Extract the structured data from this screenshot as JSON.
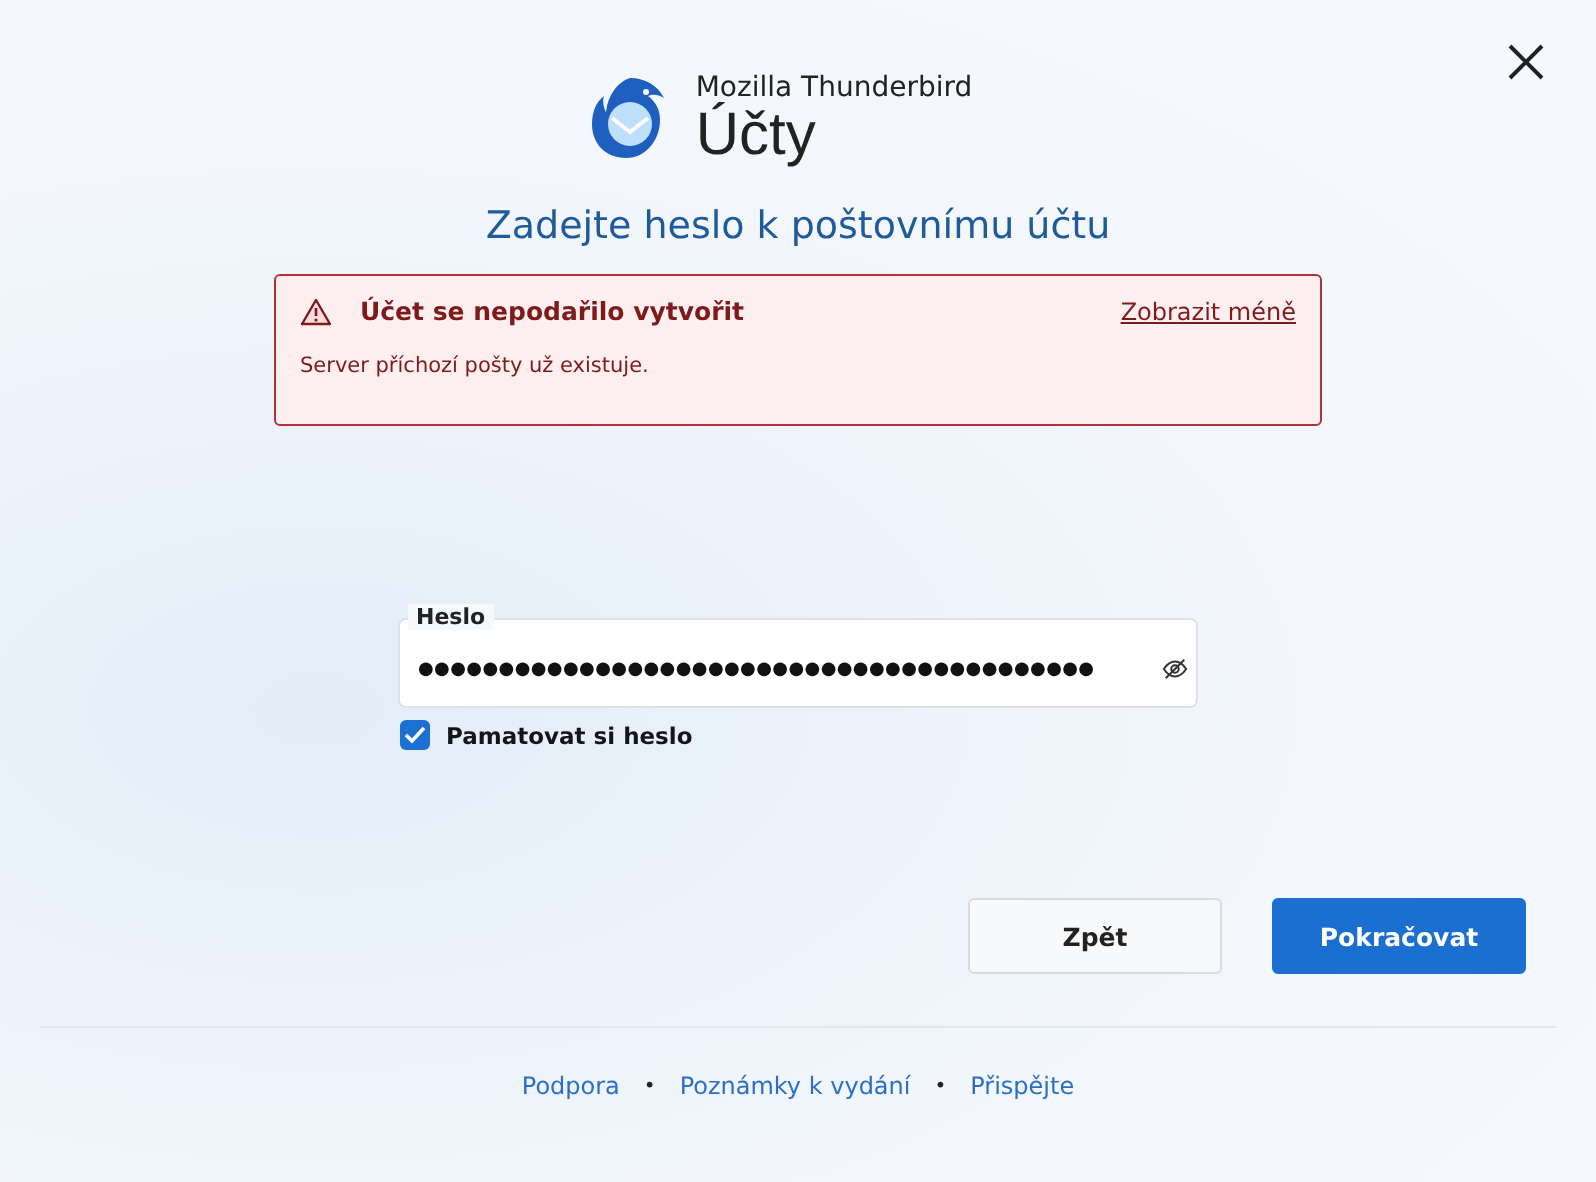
{
  "header": {
    "brand": "Mozilla Thunderbird",
    "title": "Účty"
  },
  "heading": "Zadejte heslo k poštovnímu účtu",
  "error": {
    "title": "Účet se nepodařilo vytvořit",
    "toggle": "Zobrazit méně",
    "message": "Server příchozí pošty už existuje."
  },
  "password": {
    "label": "Heslo",
    "value": "●●●●●●●●●●●●●●●●●●●●●●●●●●●●●●●●●●●●●●●●●●"
  },
  "remember": {
    "label": "Pamatovat si heslo",
    "checked": true
  },
  "buttons": [
    {
      "label": "Zpět",
      "kind": "secondary"
    },
    {
      "label": "Pokračovat",
      "kind": "primary"
    }
  ],
  "footer": {
    "separator": "•",
    "links": [
      "Podpora",
      "Poznámky k vydání",
      "Přispějte"
    ]
  }
}
